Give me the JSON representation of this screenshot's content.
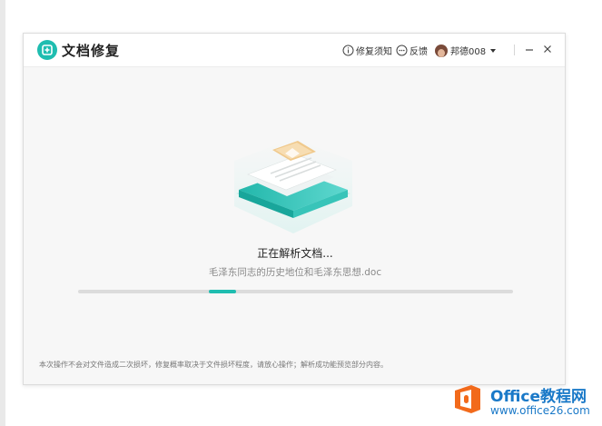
{
  "app": {
    "title": "文档修复"
  },
  "header": {
    "help_label": "修复须知",
    "feedback_label": "反馈",
    "user_name": "邦德008"
  },
  "main": {
    "status": "正在解析文档...",
    "file_name": "毛泽东同志的历史地位和毛泽东思想.doc",
    "progress_fraction": 0.06
  },
  "footer": {
    "note": "本次操作不会对文件造成二次损坏，修复概率取决于文件损坏程度，请放心操作；解析成功能预览部分内容。"
  },
  "watermark": {
    "brand": "Office教程网",
    "url": "www.office26.com"
  },
  "colors": {
    "accent": "#1fbdb0",
    "watermark": "#1a79c8",
    "watermark_orange": "#f26a1b"
  },
  "icons": [
    "document-repair-logo-icon",
    "info-icon",
    "chat-bubble-icon",
    "avatar",
    "chevron-down-icon",
    "minimize-icon",
    "close-icon"
  ]
}
